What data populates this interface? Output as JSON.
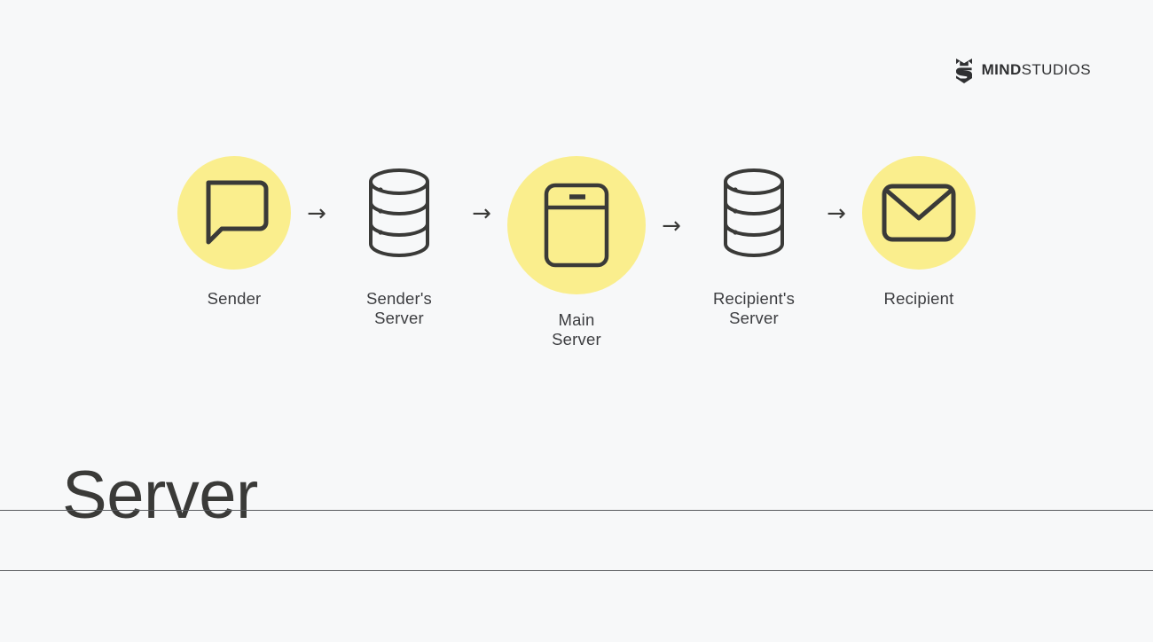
{
  "brand": {
    "logo_icon": "mindstudios-shield-icon",
    "name_bold": "MIND",
    "name_regular": "STUDIOS"
  },
  "title": "Server",
  "flow": {
    "arrow_glyph": "→",
    "accent_color": "#FAEE8D",
    "stroke_color": "#3A3A38",
    "background_color": "#F7F8F9",
    "nodes": [
      {
        "id": "sender",
        "label": "Sender",
        "icon": "chat-bubble-icon",
        "highlighted": true,
        "size": "small"
      },
      {
        "id": "senders-server",
        "label": "Sender's\nServer",
        "icon": "database-icon",
        "highlighted": false,
        "size": "small"
      },
      {
        "id": "main-server",
        "label": "Main\nServer",
        "icon": "server-icon",
        "highlighted": true,
        "size": "large"
      },
      {
        "id": "recipients-server",
        "label": "Recipient's\nServer",
        "icon": "database-icon",
        "highlighted": false,
        "size": "small"
      },
      {
        "id": "recipient",
        "label": "Recipient",
        "icon": "envelope-icon",
        "highlighted": true,
        "size": "small"
      }
    ],
    "arrows": [
      "→",
      "→",
      "→",
      "→"
    ]
  }
}
